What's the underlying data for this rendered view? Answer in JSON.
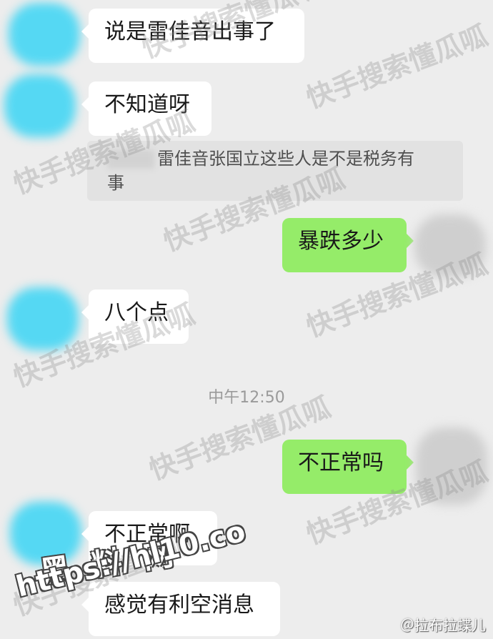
{
  "messages": [
    {
      "side": "in",
      "text": "说是雷佳音出事了"
    },
    {
      "side": "in",
      "text": "不知道呀"
    },
    {
      "side": "quote",
      "line1": "雷佳音张国立这些人是不是税务有",
      "line2": "事"
    },
    {
      "side": "out",
      "text": "暴跌多少"
    },
    {
      "side": "in",
      "text": "八个点"
    },
    {
      "side": "out",
      "text": "不正常吗"
    },
    {
      "side": "in",
      "text": "不正常啊"
    },
    {
      "side": "in",
      "text": "感觉有利空消息"
    }
  ],
  "timestamp": "中午12:50",
  "watermarks": {
    "app_text": "快手搜索懂瓜呱",
    "site_name": "黑 料 网",
    "site_url": "https://hl10.co",
    "credit": "＠拉布拉蝶儿"
  },
  "colors": {
    "background": "#ededed",
    "incoming_bubble": "#ffffff",
    "outgoing_bubble": "#95ec69",
    "avatar_incoming": "#55d8f3"
  }
}
